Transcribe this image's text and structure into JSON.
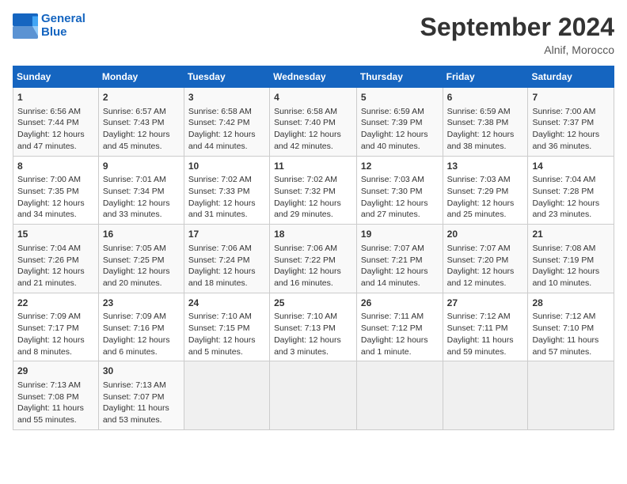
{
  "header": {
    "logo_line1": "General",
    "logo_line2": "Blue",
    "month": "September 2024",
    "location": "Alnif, Morocco"
  },
  "days_of_week": [
    "Sunday",
    "Monday",
    "Tuesday",
    "Wednesday",
    "Thursday",
    "Friday",
    "Saturday"
  ],
  "weeks": [
    [
      {
        "day": "1",
        "lines": [
          "Sunrise: 6:56 AM",
          "Sunset: 7:44 PM",
          "Daylight: 12 hours",
          "and 47 minutes."
        ]
      },
      {
        "day": "2",
        "lines": [
          "Sunrise: 6:57 AM",
          "Sunset: 7:43 PM",
          "Daylight: 12 hours",
          "and 45 minutes."
        ]
      },
      {
        "day": "3",
        "lines": [
          "Sunrise: 6:58 AM",
          "Sunset: 7:42 PM",
          "Daylight: 12 hours",
          "and 44 minutes."
        ]
      },
      {
        "day": "4",
        "lines": [
          "Sunrise: 6:58 AM",
          "Sunset: 7:40 PM",
          "Daylight: 12 hours",
          "and 42 minutes."
        ]
      },
      {
        "day": "5",
        "lines": [
          "Sunrise: 6:59 AM",
          "Sunset: 7:39 PM",
          "Daylight: 12 hours",
          "and 40 minutes."
        ]
      },
      {
        "day": "6",
        "lines": [
          "Sunrise: 6:59 AM",
          "Sunset: 7:38 PM",
          "Daylight: 12 hours",
          "and 38 minutes."
        ]
      },
      {
        "day": "7",
        "lines": [
          "Sunrise: 7:00 AM",
          "Sunset: 7:37 PM",
          "Daylight: 12 hours",
          "and 36 minutes."
        ]
      }
    ],
    [
      {
        "day": "8",
        "lines": [
          "Sunrise: 7:00 AM",
          "Sunset: 7:35 PM",
          "Daylight: 12 hours",
          "and 34 minutes."
        ]
      },
      {
        "day": "9",
        "lines": [
          "Sunrise: 7:01 AM",
          "Sunset: 7:34 PM",
          "Daylight: 12 hours",
          "and 33 minutes."
        ]
      },
      {
        "day": "10",
        "lines": [
          "Sunrise: 7:02 AM",
          "Sunset: 7:33 PM",
          "Daylight: 12 hours",
          "and 31 minutes."
        ]
      },
      {
        "day": "11",
        "lines": [
          "Sunrise: 7:02 AM",
          "Sunset: 7:32 PM",
          "Daylight: 12 hours",
          "and 29 minutes."
        ]
      },
      {
        "day": "12",
        "lines": [
          "Sunrise: 7:03 AM",
          "Sunset: 7:30 PM",
          "Daylight: 12 hours",
          "and 27 minutes."
        ]
      },
      {
        "day": "13",
        "lines": [
          "Sunrise: 7:03 AM",
          "Sunset: 7:29 PM",
          "Daylight: 12 hours",
          "and 25 minutes."
        ]
      },
      {
        "day": "14",
        "lines": [
          "Sunrise: 7:04 AM",
          "Sunset: 7:28 PM",
          "Daylight: 12 hours",
          "and 23 minutes."
        ]
      }
    ],
    [
      {
        "day": "15",
        "lines": [
          "Sunrise: 7:04 AM",
          "Sunset: 7:26 PM",
          "Daylight: 12 hours",
          "and 21 minutes."
        ]
      },
      {
        "day": "16",
        "lines": [
          "Sunrise: 7:05 AM",
          "Sunset: 7:25 PM",
          "Daylight: 12 hours",
          "and 20 minutes."
        ]
      },
      {
        "day": "17",
        "lines": [
          "Sunrise: 7:06 AM",
          "Sunset: 7:24 PM",
          "Daylight: 12 hours",
          "and 18 minutes."
        ]
      },
      {
        "day": "18",
        "lines": [
          "Sunrise: 7:06 AM",
          "Sunset: 7:22 PM",
          "Daylight: 12 hours",
          "and 16 minutes."
        ]
      },
      {
        "day": "19",
        "lines": [
          "Sunrise: 7:07 AM",
          "Sunset: 7:21 PM",
          "Daylight: 12 hours",
          "and 14 minutes."
        ]
      },
      {
        "day": "20",
        "lines": [
          "Sunrise: 7:07 AM",
          "Sunset: 7:20 PM",
          "Daylight: 12 hours",
          "and 12 minutes."
        ]
      },
      {
        "day": "21",
        "lines": [
          "Sunrise: 7:08 AM",
          "Sunset: 7:19 PM",
          "Daylight: 12 hours",
          "and 10 minutes."
        ]
      }
    ],
    [
      {
        "day": "22",
        "lines": [
          "Sunrise: 7:09 AM",
          "Sunset: 7:17 PM",
          "Daylight: 12 hours",
          "and 8 minutes."
        ]
      },
      {
        "day": "23",
        "lines": [
          "Sunrise: 7:09 AM",
          "Sunset: 7:16 PM",
          "Daylight: 12 hours",
          "and 6 minutes."
        ]
      },
      {
        "day": "24",
        "lines": [
          "Sunrise: 7:10 AM",
          "Sunset: 7:15 PM",
          "Daylight: 12 hours",
          "and 5 minutes."
        ]
      },
      {
        "day": "25",
        "lines": [
          "Sunrise: 7:10 AM",
          "Sunset: 7:13 PM",
          "Daylight: 12 hours",
          "and 3 minutes."
        ]
      },
      {
        "day": "26",
        "lines": [
          "Sunrise: 7:11 AM",
          "Sunset: 7:12 PM",
          "Daylight: 12 hours",
          "and 1 minute."
        ]
      },
      {
        "day": "27",
        "lines": [
          "Sunrise: 7:12 AM",
          "Sunset: 7:11 PM",
          "Daylight: 11 hours",
          "and 59 minutes."
        ]
      },
      {
        "day": "28",
        "lines": [
          "Sunrise: 7:12 AM",
          "Sunset: 7:10 PM",
          "Daylight: 11 hours",
          "and 57 minutes."
        ]
      }
    ],
    [
      {
        "day": "29",
        "lines": [
          "Sunrise: 7:13 AM",
          "Sunset: 7:08 PM",
          "Daylight: 11 hours",
          "and 55 minutes."
        ]
      },
      {
        "day": "30",
        "lines": [
          "Sunrise: 7:13 AM",
          "Sunset: 7:07 PM",
          "Daylight: 11 hours",
          "and 53 minutes."
        ]
      },
      {
        "day": "",
        "lines": []
      },
      {
        "day": "",
        "lines": []
      },
      {
        "day": "",
        "lines": []
      },
      {
        "day": "",
        "lines": []
      },
      {
        "day": "",
        "lines": []
      }
    ]
  ]
}
